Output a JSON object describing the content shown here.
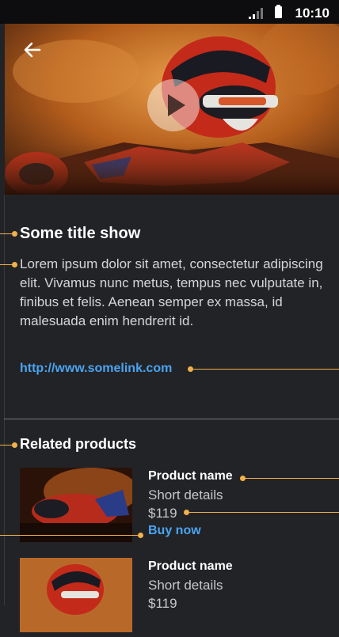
{
  "status_bar": {
    "time": "10:10"
  },
  "detail": {
    "title": "Some title show",
    "description": "Lorem ipsum dolor sit amet, consectetur adipiscing elit. Vivamus nunc metus, tempus nec vulputate in, finibus et felis. Aenean semper ex massa, id malesuada enim hendrerit id.",
    "link": "http://www.somelink.com"
  },
  "related": {
    "title": "Related products",
    "items": [
      {
        "name": "Product name",
        "details": "Short details",
        "price": "$119",
        "action": "Buy now"
      },
      {
        "name": "Product name",
        "details": "Short details",
        "price": "$119"
      }
    ]
  },
  "colors": {
    "background": "#222327",
    "link": "#4aa4f0",
    "annotation": "#f2b14a"
  },
  "icons": [
    "back-arrow-icon",
    "play-icon",
    "signal-icon",
    "battery-icon"
  ]
}
